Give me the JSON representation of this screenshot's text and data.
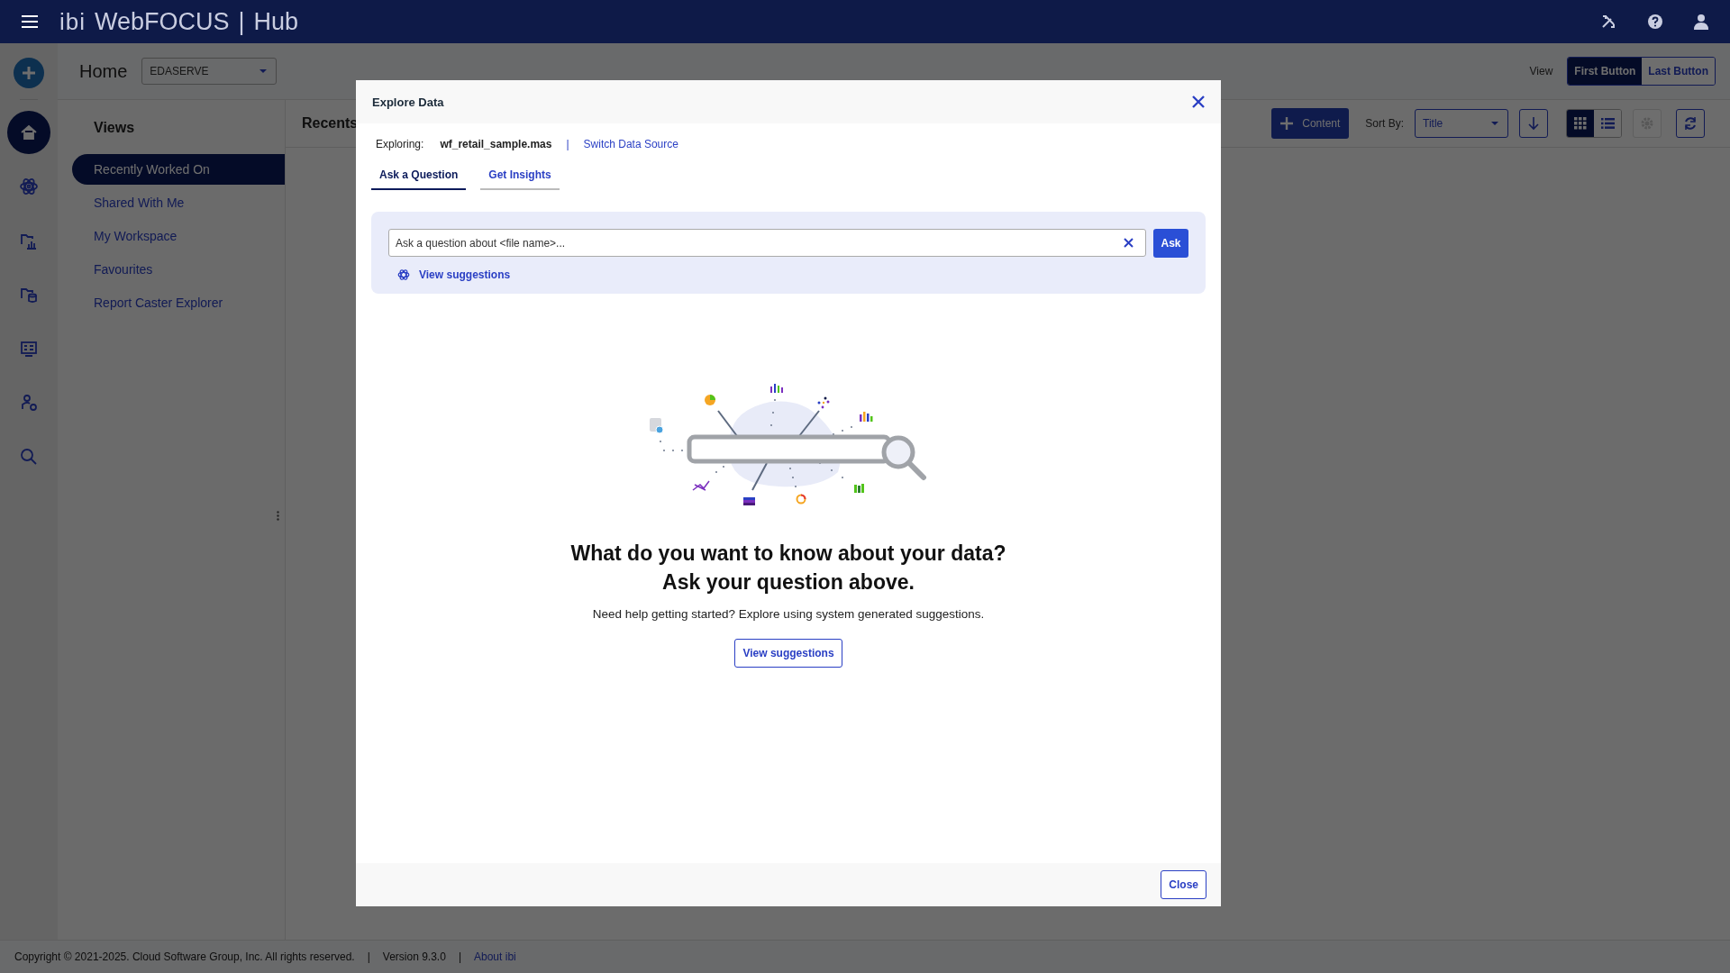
{
  "header": {
    "logo": "ibi",
    "product": "WebFOCUS",
    "separator": "|",
    "app": "Hub"
  },
  "rail": {
    "items": [
      {
        "kind": "home",
        "selected": true
      },
      {
        "kind": "atom",
        "selected": false
      },
      {
        "kind": "folder-chart",
        "selected": false
      },
      {
        "kind": "folder-db",
        "selected": false
      },
      {
        "kind": "monitor",
        "selected": false
      },
      {
        "kind": "user-gear",
        "selected": false
      },
      {
        "kind": "search",
        "selected": false
      }
    ]
  },
  "home": {
    "title": "Home",
    "server_select": "EDASERVE",
    "view_label": "View",
    "view_buttons": [
      {
        "label": "First Button",
        "selected": true
      },
      {
        "label": "Last Button",
        "selected": false
      }
    ]
  },
  "views": {
    "title": "Views",
    "items": [
      {
        "label": "Recently Worked On",
        "selected": true
      },
      {
        "label": "Shared With Me",
        "selected": false
      },
      {
        "label": "My Workspace",
        "selected": false
      },
      {
        "label": "Favourites",
        "selected": false
      },
      {
        "label": "Report Caster Explorer",
        "selected": false
      }
    ]
  },
  "recents": {
    "title": "Recents",
    "content_button": "Content",
    "sort_label": "Sort By:",
    "sort_value": "Title",
    "layouts": [
      {
        "kind": "grid",
        "selected": true
      },
      {
        "kind": "list",
        "selected": false
      }
    ],
    "settings_disabled": true
  },
  "footer": {
    "copyright": "Copyright © 2021-2025. Cloud Software Group, Inc. All rights reserved.",
    "version": "Version 9.3.0",
    "separator": "|",
    "about_link": "About ibi"
  },
  "dialog": {
    "title": "Explore Data",
    "exploring_label": "Exploring:",
    "source": "wf_retail_sample.mas",
    "separator": "|",
    "switch_link": "Switch Data Source",
    "tabs": [
      {
        "label": "Ask a Question",
        "selected": true
      },
      {
        "label": "Get Insights",
        "selected": false
      }
    ],
    "question": {
      "placeholder": "Ask a question about <file name>...",
      "ask_button": "Ask",
      "suggestions_link": "View suggestions"
    },
    "empty_state": {
      "heading_lines": [
        "What do you want to know about your data?",
        "Ask your question above."
      ],
      "text": "Need help getting started? Explore using system generated suggestions.",
      "button": "View suggestions"
    },
    "close_button": "Close"
  }
}
